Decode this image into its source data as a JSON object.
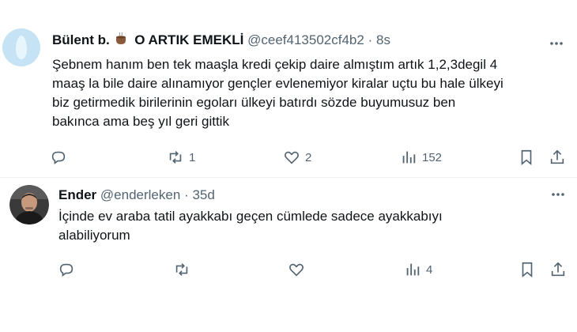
{
  "tweets": [
    {
      "name": "Bülent b.",
      "name_suffix": "O ARTIK EMEKLİ",
      "handle": "@ceef413502cf4b2",
      "separator": "·",
      "time": "8s",
      "text_lines": [
        "Şebnem hanım ben tek maaşla kredi çekip daire almıştım artık 1,2,3degil 4",
        "maaş la bile daire alınamıyor gençler evlenemiyor kiralar uçtu bu hale ülkeyi",
        "biz getirmedik birilerinin egoları ülkeyi batırdı sözde buyumusuz ben",
        "bakınca ama beş yıl geri gittik"
      ],
      "stats": {
        "replies": "",
        "reposts": "1",
        "likes": "2",
        "views": "152"
      }
    },
    {
      "name": "Ender",
      "handle": "@enderleken",
      "separator": "·",
      "time": "35d",
      "text_lines": [
        "İçinde ev araba tatil ayakkabı geçen cümlede  sadece ayakkabıyı",
        "alabiliyorum"
      ],
      "stats": {
        "replies": "",
        "reposts": "",
        "likes": "",
        "views": "4"
      }
    }
  ],
  "icons": {
    "reply": "reply-icon",
    "repost": "repost-icon",
    "like": "heart-icon",
    "views": "views-icon",
    "bookmark": "bookmark-icon",
    "share": "share-icon",
    "more": "more-icon"
  },
  "colors": {
    "text": "#0f1419",
    "secondary": "#536471",
    "divider": "#eff3f4"
  }
}
